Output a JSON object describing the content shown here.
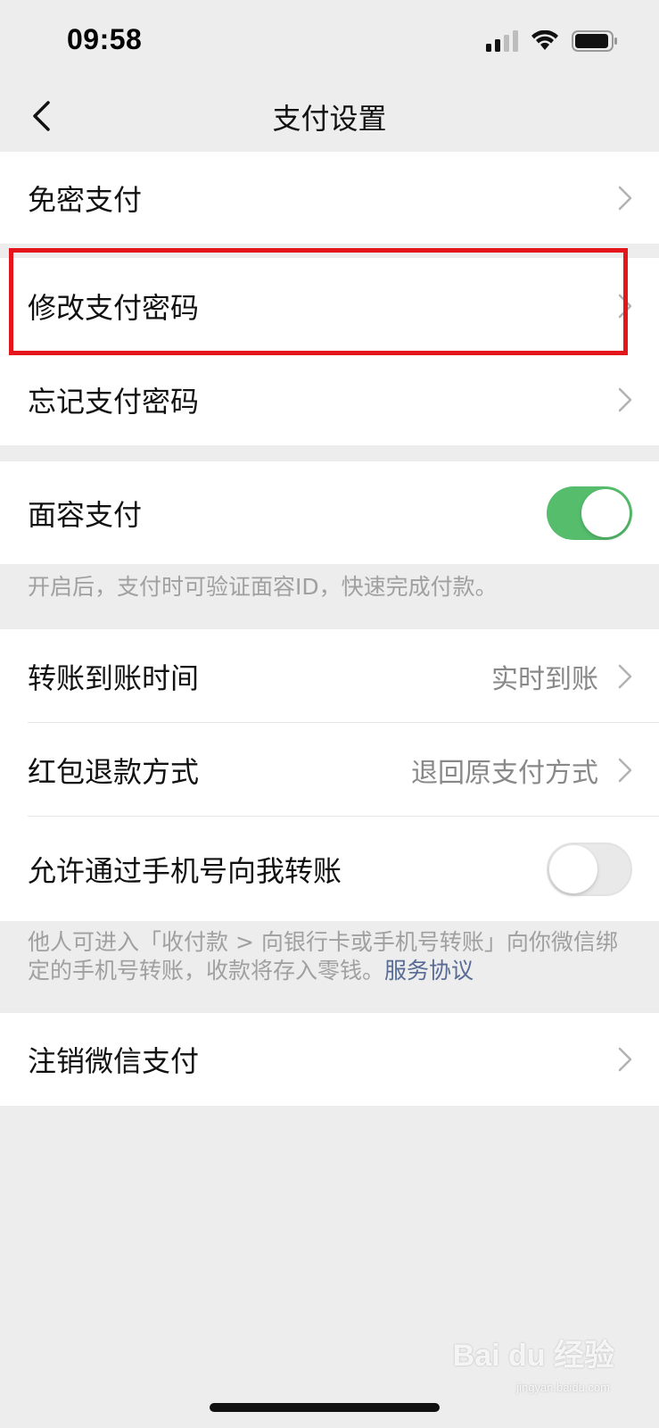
{
  "status_bar": {
    "time": "09:58",
    "icons": [
      "signal-icon",
      "wifi-icon",
      "battery-icon"
    ]
  },
  "nav": {
    "title": "支付设置",
    "back_icon": "chevron-left-icon"
  },
  "group_free_pay": {
    "items": [
      {
        "label": "免密支付"
      }
    ]
  },
  "group_password": {
    "items": [
      {
        "label": "修改支付密码"
      },
      {
        "label": "忘记支付密码"
      }
    ]
  },
  "group_face": {
    "label": "面容支付",
    "enabled": true,
    "note": "开启后，支付时可验证面容ID，快速完成付款。"
  },
  "group_transfer": {
    "items": [
      {
        "label": "转账到账时间",
        "value": "实时到账"
      },
      {
        "label": "红包退款方式",
        "value": "退回原支付方式"
      }
    ],
    "phone_transfer": {
      "label": "允许通过手机号向我转账",
      "enabled": false
    },
    "note": "他人可进入「收付款 > 向银行卡或手机号转账」向你微信绑定的手机号转账，收款将存入零钱。",
    "note_link": "服务协议"
  },
  "group_cancel": {
    "items": [
      {
        "label": "注销微信支付"
      }
    ]
  },
  "watermark": {
    "text": "Bai du 经验",
    "sub": "jingyan.baidu.com"
  },
  "colors": {
    "background": "#ededed",
    "toggle_on": "#55bd6c",
    "link": "#576b95",
    "highlight": "#e5161b"
  }
}
